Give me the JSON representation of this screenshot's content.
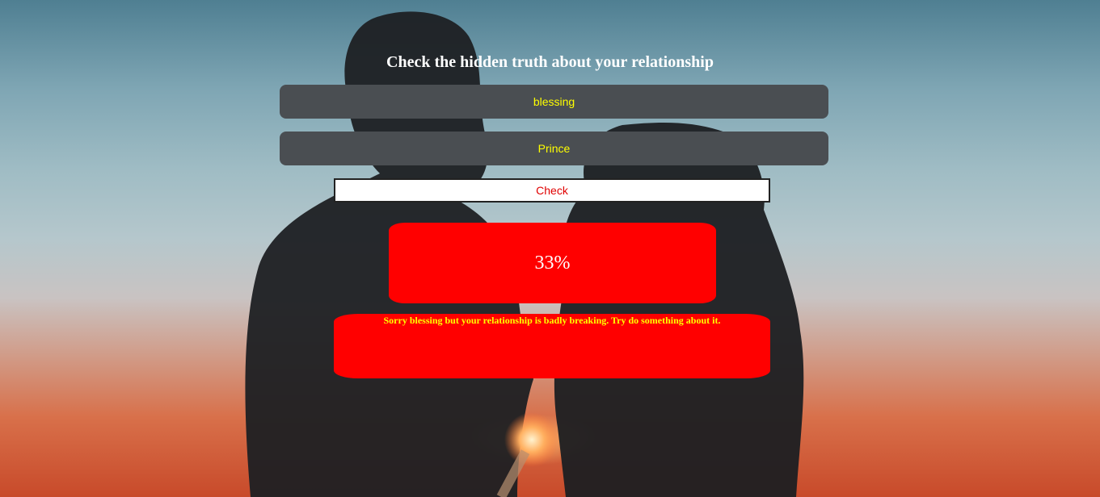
{
  "title": "Check the hidden truth about your relationship",
  "form": {
    "name_one": "blessing",
    "name_two": "Prince",
    "check_label": "Check"
  },
  "result": {
    "percent": "33%",
    "percent_value": 33,
    "message": "Sorry blessing but your relationship is badly breaking. Try do something about it."
  },
  "colors": {
    "title": "#ffffff",
    "field_background": "#4a4e52",
    "field_text": "#ffff00",
    "button_text": "#e00000",
    "result_background": "#ff0000",
    "percent_text": "#ffffff",
    "message_text": "#ffff00"
  },
  "background": {
    "description_icon": "couple-silhouette-sunset-image"
  }
}
